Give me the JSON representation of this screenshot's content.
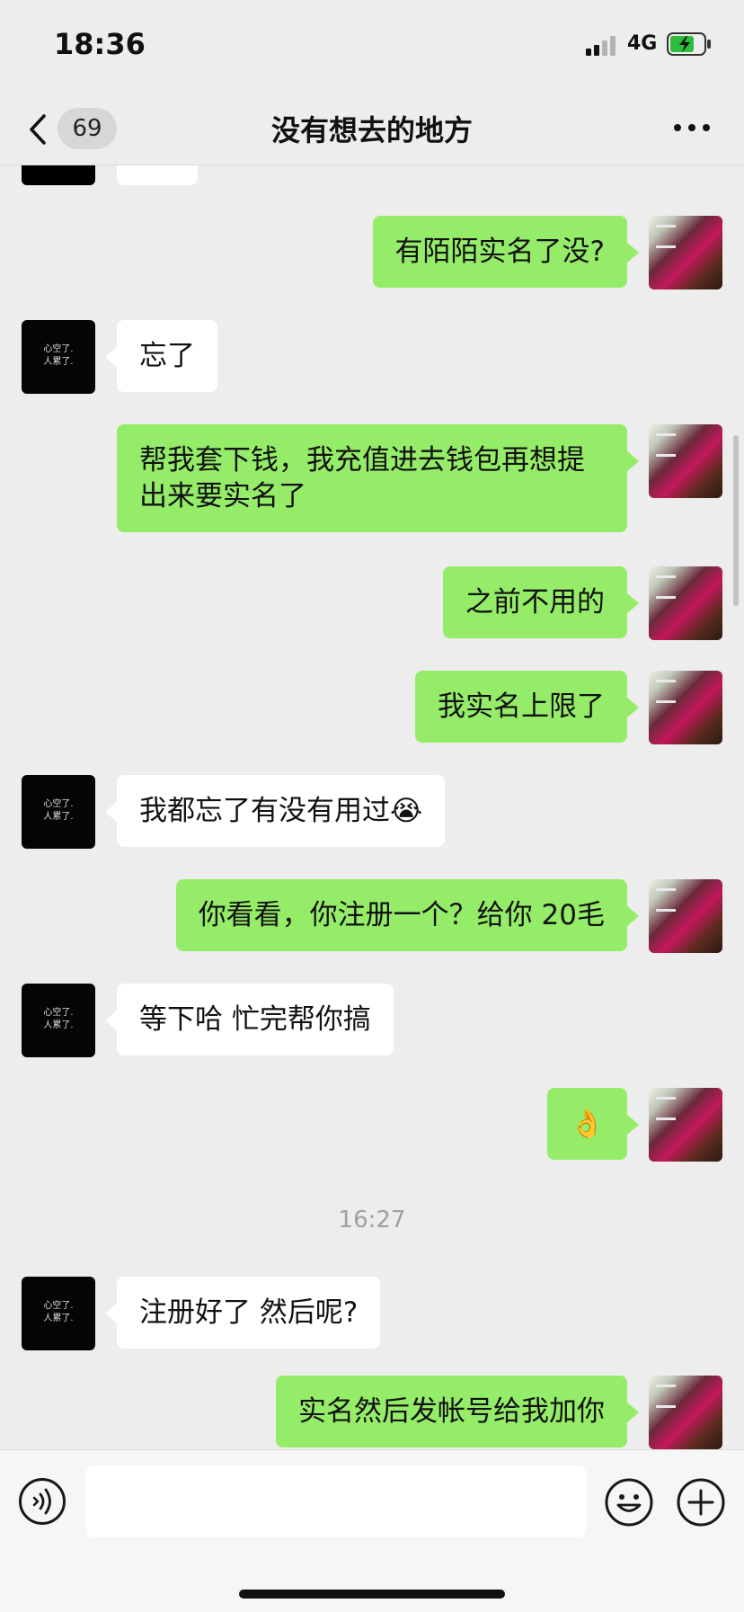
{
  "status_bar": {
    "time": "18:36",
    "network": "4G"
  },
  "nav": {
    "unread_count": "69",
    "title": "没有想去的地方"
  },
  "contact_avatar_text": [
    "心空了.",
    "人累了."
  ],
  "messages": [
    {
      "from": "self",
      "text": "有陌陌实名了没?"
    },
    {
      "from": "other",
      "text": "忘了"
    },
    {
      "from": "self",
      "text": "帮我套下钱，我充值进去钱包再想提出来要实名了"
    },
    {
      "from": "self",
      "text": "之前不用的"
    },
    {
      "from": "self",
      "text": "我实名上限了"
    },
    {
      "from": "other",
      "text": "我都忘了有没有用过😭"
    },
    {
      "from": "self",
      "text": "你看看，你注册一个？给你 20毛"
    },
    {
      "from": "other",
      "text": "等下哈  忙完帮你搞"
    },
    {
      "from": "self",
      "text": "👌"
    },
    {
      "from": "other",
      "text": "注册好了 然后呢?"
    },
    {
      "from": "self",
      "text": "实名然后发帐号给我加你"
    }
  ],
  "timestamp": "16:27",
  "input": {
    "placeholder": ""
  },
  "icons": {
    "back": "chevron-left-icon",
    "more": "more-dots-icon",
    "voice": "voice-icon",
    "emoji": "emoji-icon",
    "plus": "plus-icon"
  },
  "colors": {
    "self_bubble": "#95ec69",
    "other_bubble": "#ffffff",
    "background": "#ededed"
  }
}
